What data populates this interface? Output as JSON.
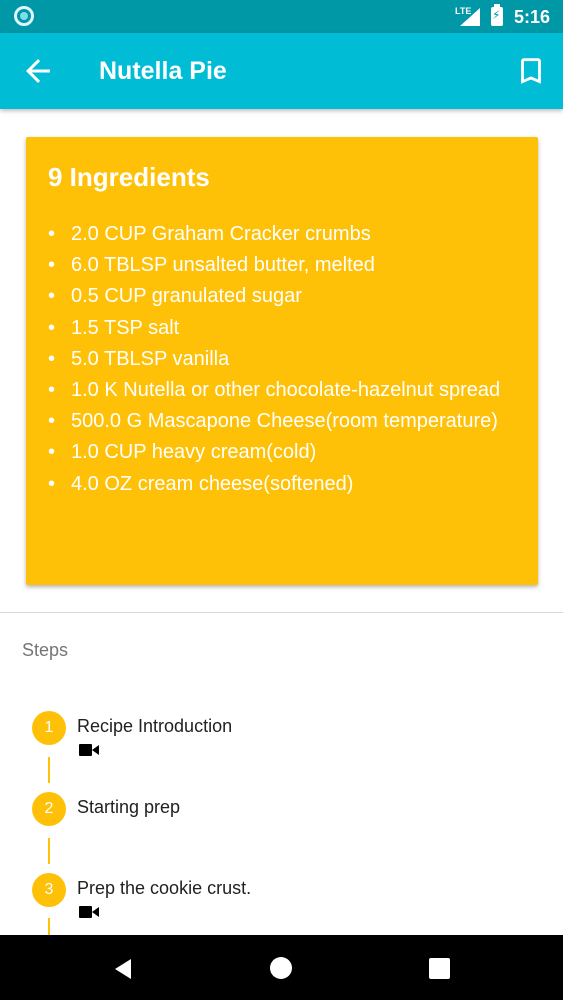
{
  "status_bar": {
    "network": "LTE",
    "time": "5:16"
  },
  "app_bar": {
    "title": "Nutella Pie",
    "back_icon": "arrow-back-icon",
    "bookmark_icon": "bookmark-icon"
  },
  "ingredients": {
    "heading": "9 Ingredients",
    "bullet": "•",
    "items": [
      "2.0 CUP  Graham Cracker crumbs",
      "6.0 TBLSP  unsalted butter, melted",
      "0.5 CUP  granulated sugar",
      "1.5 TSP  salt",
      "5.0 TBLSP  vanilla",
      "1.0 K  Nutella or other chocolate-hazelnut spread",
      "500.0 G  Mascapone Cheese(room temperature)",
      "1.0 CUP  heavy cream(cold)",
      "4.0 OZ  cream cheese(softened)"
    ]
  },
  "steps": {
    "label": "Steps",
    "items": [
      {
        "number": "1",
        "title": "Recipe Introduction",
        "has_video": true
      },
      {
        "number": "2",
        "title": "Starting prep",
        "has_video": false
      },
      {
        "number": "3",
        "title": "Prep the cookie crust.",
        "has_video": true
      }
    ]
  },
  "colors": {
    "status_bar": "#0097a7",
    "app_bar": "#00bcd4",
    "accent": "#ffc107"
  },
  "nav_bar": {
    "back_icon": "triangle-back-icon",
    "home_icon": "circle-home-icon",
    "recents_icon": "square-recents-icon"
  }
}
